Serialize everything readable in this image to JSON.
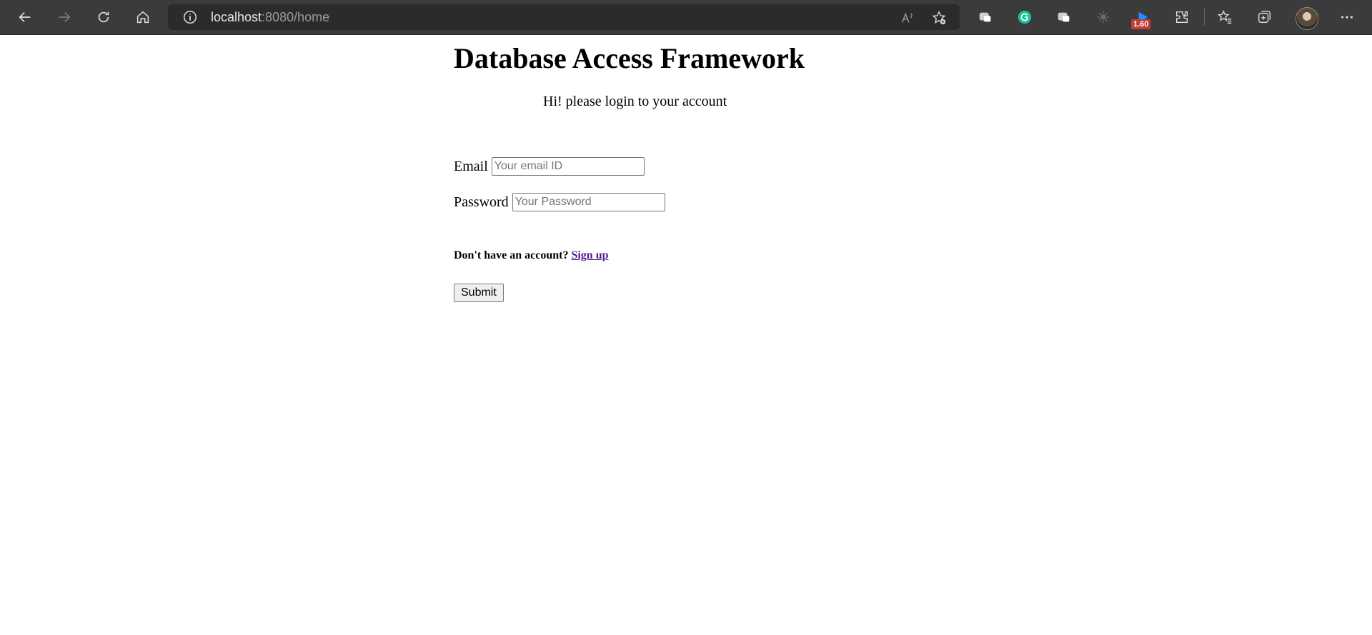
{
  "browser": {
    "url_host": "localhost",
    "url_rest": ":8080/home",
    "extension_badge": "1.60",
    "icons": [
      "back-icon",
      "forward-icon",
      "refresh-icon",
      "home-icon",
      "info-icon",
      "read-aloud-icon",
      "add-favorite-icon",
      "extension-icon",
      "grammarly-icon",
      "extension-icon",
      "extension-icon",
      "extension-icon",
      "extensions-icon",
      "favorites-icon",
      "collections-icon",
      "profile-avatar",
      "more-icon"
    ]
  },
  "page": {
    "title": "Database Access Framework",
    "greeting": "Hi! please login to your account",
    "email_label": "Email",
    "email_placeholder": "Your email ID",
    "password_label": "Password",
    "password_placeholder": "Your Password",
    "signup_prompt": "Don't have an account?",
    "signup_link": "Sign up",
    "submit_label": "Submit"
  }
}
